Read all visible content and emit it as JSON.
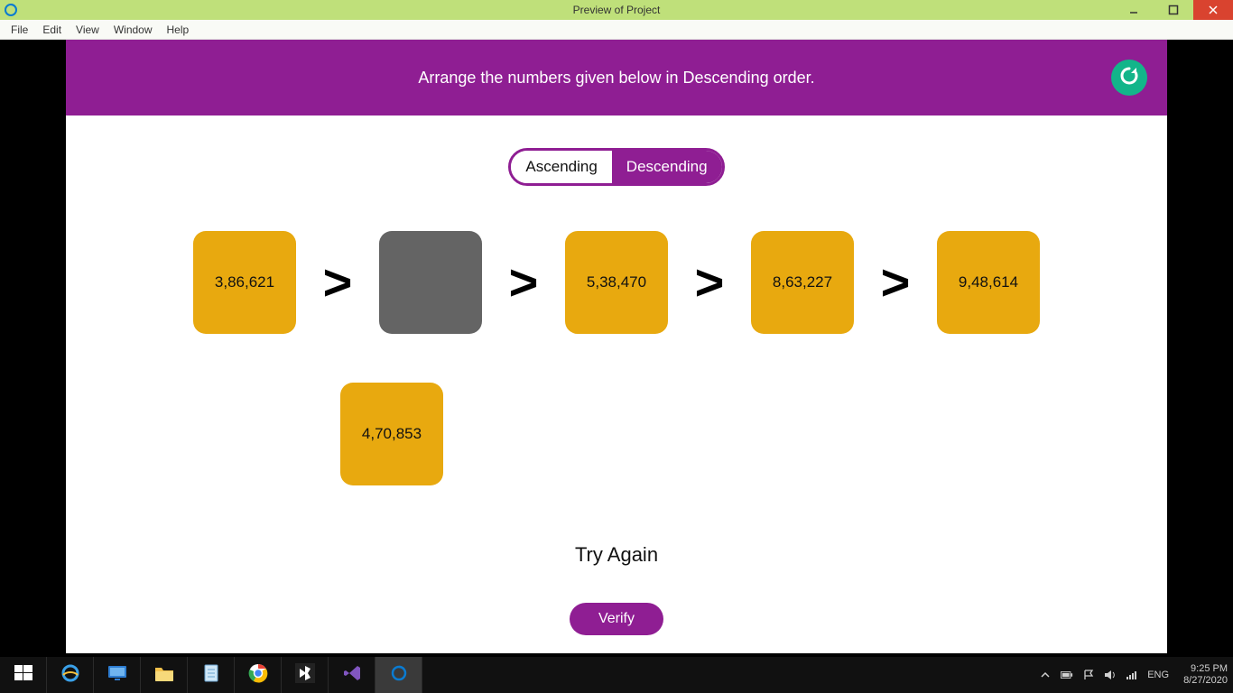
{
  "titlebar": {
    "title": "Preview of Project"
  },
  "menubar": {
    "items": [
      "File",
      "Edit",
      "View",
      "Window",
      "Help"
    ]
  },
  "game": {
    "header_title": "Arrange the numbers given below in Descending order.",
    "toggle": {
      "ascending": "Ascending",
      "descending": "Descending",
      "selected": "descending"
    },
    "comparator": ">",
    "slots": [
      {
        "value": "3,86,621",
        "empty": false
      },
      {
        "value": "",
        "empty": true
      },
      {
        "value": "5,38,470",
        "empty": false
      },
      {
        "value": "8,63,227",
        "empty": false
      },
      {
        "value": "9,48,614",
        "empty": false
      }
    ],
    "loose": [
      {
        "value": "4,70,853"
      }
    ],
    "status_text": "Try Again",
    "verify_label": "Verify"
  },
  "taskbar": {
    "language": "ENG",
    "time": "9:25 PM",
    "date": "8/27/2020"
  }
}
